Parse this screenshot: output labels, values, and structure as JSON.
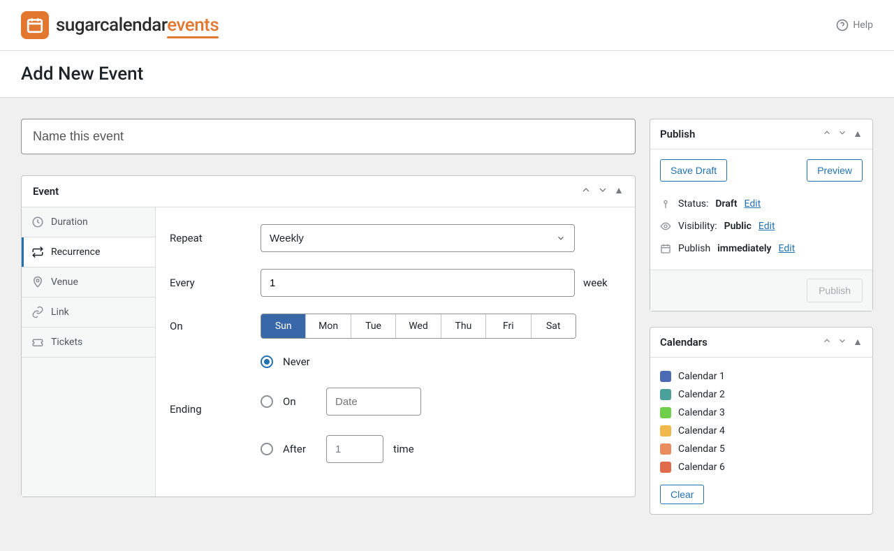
{
  "help_label": "Help",
  "page_title": "Add New Event",
  "title_placeholder": "Name this event",
  "event_panel": {
    "title": "Event",
    "tabs": {
      "duration": "Duration",
      "recurrence": "Recurrence",
      "venue": "Venue",
      "link": "Link",
      "tickets": "Tickets"
    },
    "labels": {
      "repeat": "Repeat",
      "every": "Every",
      "on": "On",
      "ending": "Ending"
    },
    "repeat_value": "Weekly",
    "every_value": "1",
    "every_unit": "week",
    "days": {
      "sun": "Sun",
      "mon": "Mon",
      "tue": "Tue",
      "wed": "Wed",
      "thu": "Thu",
      "fri": "Fri",
      "sat": "Sat"
    },
    "ending": {
      "never": "Never",
      "on": "On",
      "date_placeholder": "Date",
      "after": "After",
      "after_value": "1",
      "after_unit": "time"
    }
  },
  "publish": {
    "title": "Publish",
    "save_draft": "Save Draft",
    "preview": "Preview",
    "status_label": "Status:",
    "status_value": "Draft",
    "visibility_label": "Visibility:",
    "visibility_value": "Public",
    "publish_label": "Publish",
    "publish_value": "immediately",
    "edit": "Edit",
    "publish_btn": "Publish"
  },
  "calendars": {
    "title": "Calendars",
    "items": [
      {
        "label": "Calendar 1",
        "color": "#4a6bb3"
      },
      {
        "label": "Calendar 2",
        "color": "#4aa199"
      },
      {
        "label": "Calendar 3",
        "color": "#6fcf4a"
      },
      {
        "label": "Calendar 4",
        "color": "#f0b84a"
      },
      {
        "label": "Calendar 5",
        "color": "#e88b5f"
      },
      {
        "label": "Calendar 6",
        "color": "#e06a4a"
      }
    ],
    "clear": "Clear"
  }
}
